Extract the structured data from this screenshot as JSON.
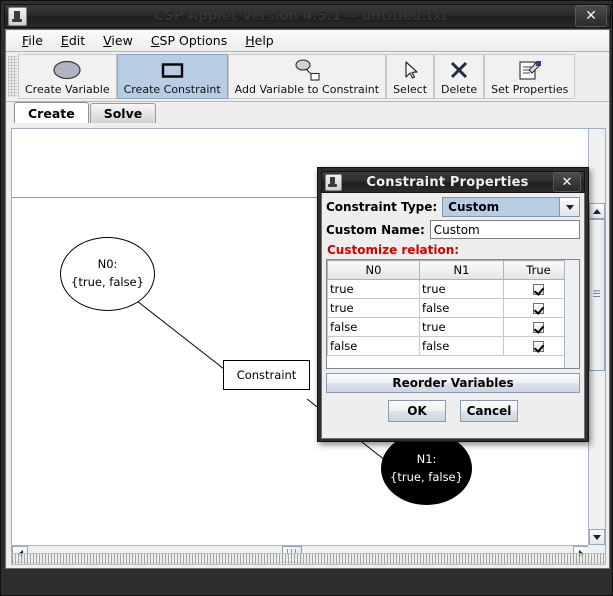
{
  "window": {
    "title": "CSP Applet Version 4.5.1 -- untitled.txt",
    "close_label": "✕",
    "app_icon": "java-coffee-cup-icon"
  },
  "menubar": {
    "items": [
      {
        "label": "File",
        "mnemonic": "F"
      },
      {
        "label": "Edit",
        "mnemonic": "E"
      },
      {
        "label": "View",
        "mnemonic": "V"
      },
      {
        "label": "CSP Options",
        "mnemonic": "C"
      },
      {
        "label": "Help",
        "mnemonic": "H"
      }
    ]
  },
  "toolbar": {
    "buttons": [
      {
        "label": "Create Variable",
        "icon": "ellipse-icon",
        "selected": false
      },
      {
        "label": "Create Constraint",
        "icon": "rectangle-icon",
        "selected": true
      },
      {
        "label": "Add Variable to Constraint",
        "icon": "link-node-icon",
        "selected": false
      },
      {
        "label": "Select",
        "icon": "cursor-arrow-icon",
        "selected": false
      },
      {
        "label": "Delete",
        "icon": "x-cross-icon",
        "selected": false
      },
      {
        "label": "Set Properties",
        "icon": "properties-sheet-icon",
        "selected": false
      }
    ]
  },
  "tabs": [
    {
      "label": "Create",
      "active": true
    },
    {
      "label": "Solve",
      "active": false
    }
  ],
  "canvas": {
    "nodes": [
      {
        "id": "N0",
        "title": "N0:",
        "domain": "{true, false}",
        "selected": false
      },
      {
        "id": "N1",
        "title": "N1:",
        "domain": "{true, false}",
        "selected": true
      }
    ],
    "constraint_box": {
      "label": "Constraint"
    }
  },
  "dialog": {
    "title": "Constraint Properties",
    "close_label": "✕",
    "constraint_type_label": "Constraint Type:",
    "constraint_type_value": "Custom",
    "custom_name_label": "Custom Name:",
    "custom_name_value": "Custom",
    "custom_name_placeholder": "Custom",
    "relation_label": "Customize relation:",
    "relation_label_color": "#d40000",
    "table": {
      "columns": [
        "N0",
        "N1",
        "True"
      ],
      "rows": [
        {
          "n0": "true",
          "n1": "true",
          "checked": true
        },
        {
          "n0": "true",
          "n1": "false",
          "checked": true
        },
        {
          "n0": "false",
          "n1": "true",
          "checked": true
        },
        {
          "n0": "false",
          "n1": "false",
          "checked": true
        }
      ]
    },
    "reorder_label": "Reorder Variables",
    "ok_label": "OK",
    "cancel_label": "Cancel"
  },
  "colors": {
    "selected_toolbar": "#b8cde4",
    "combo_bg": "#b8cde4",
    "accent_red": "#d40000"
  }
}
